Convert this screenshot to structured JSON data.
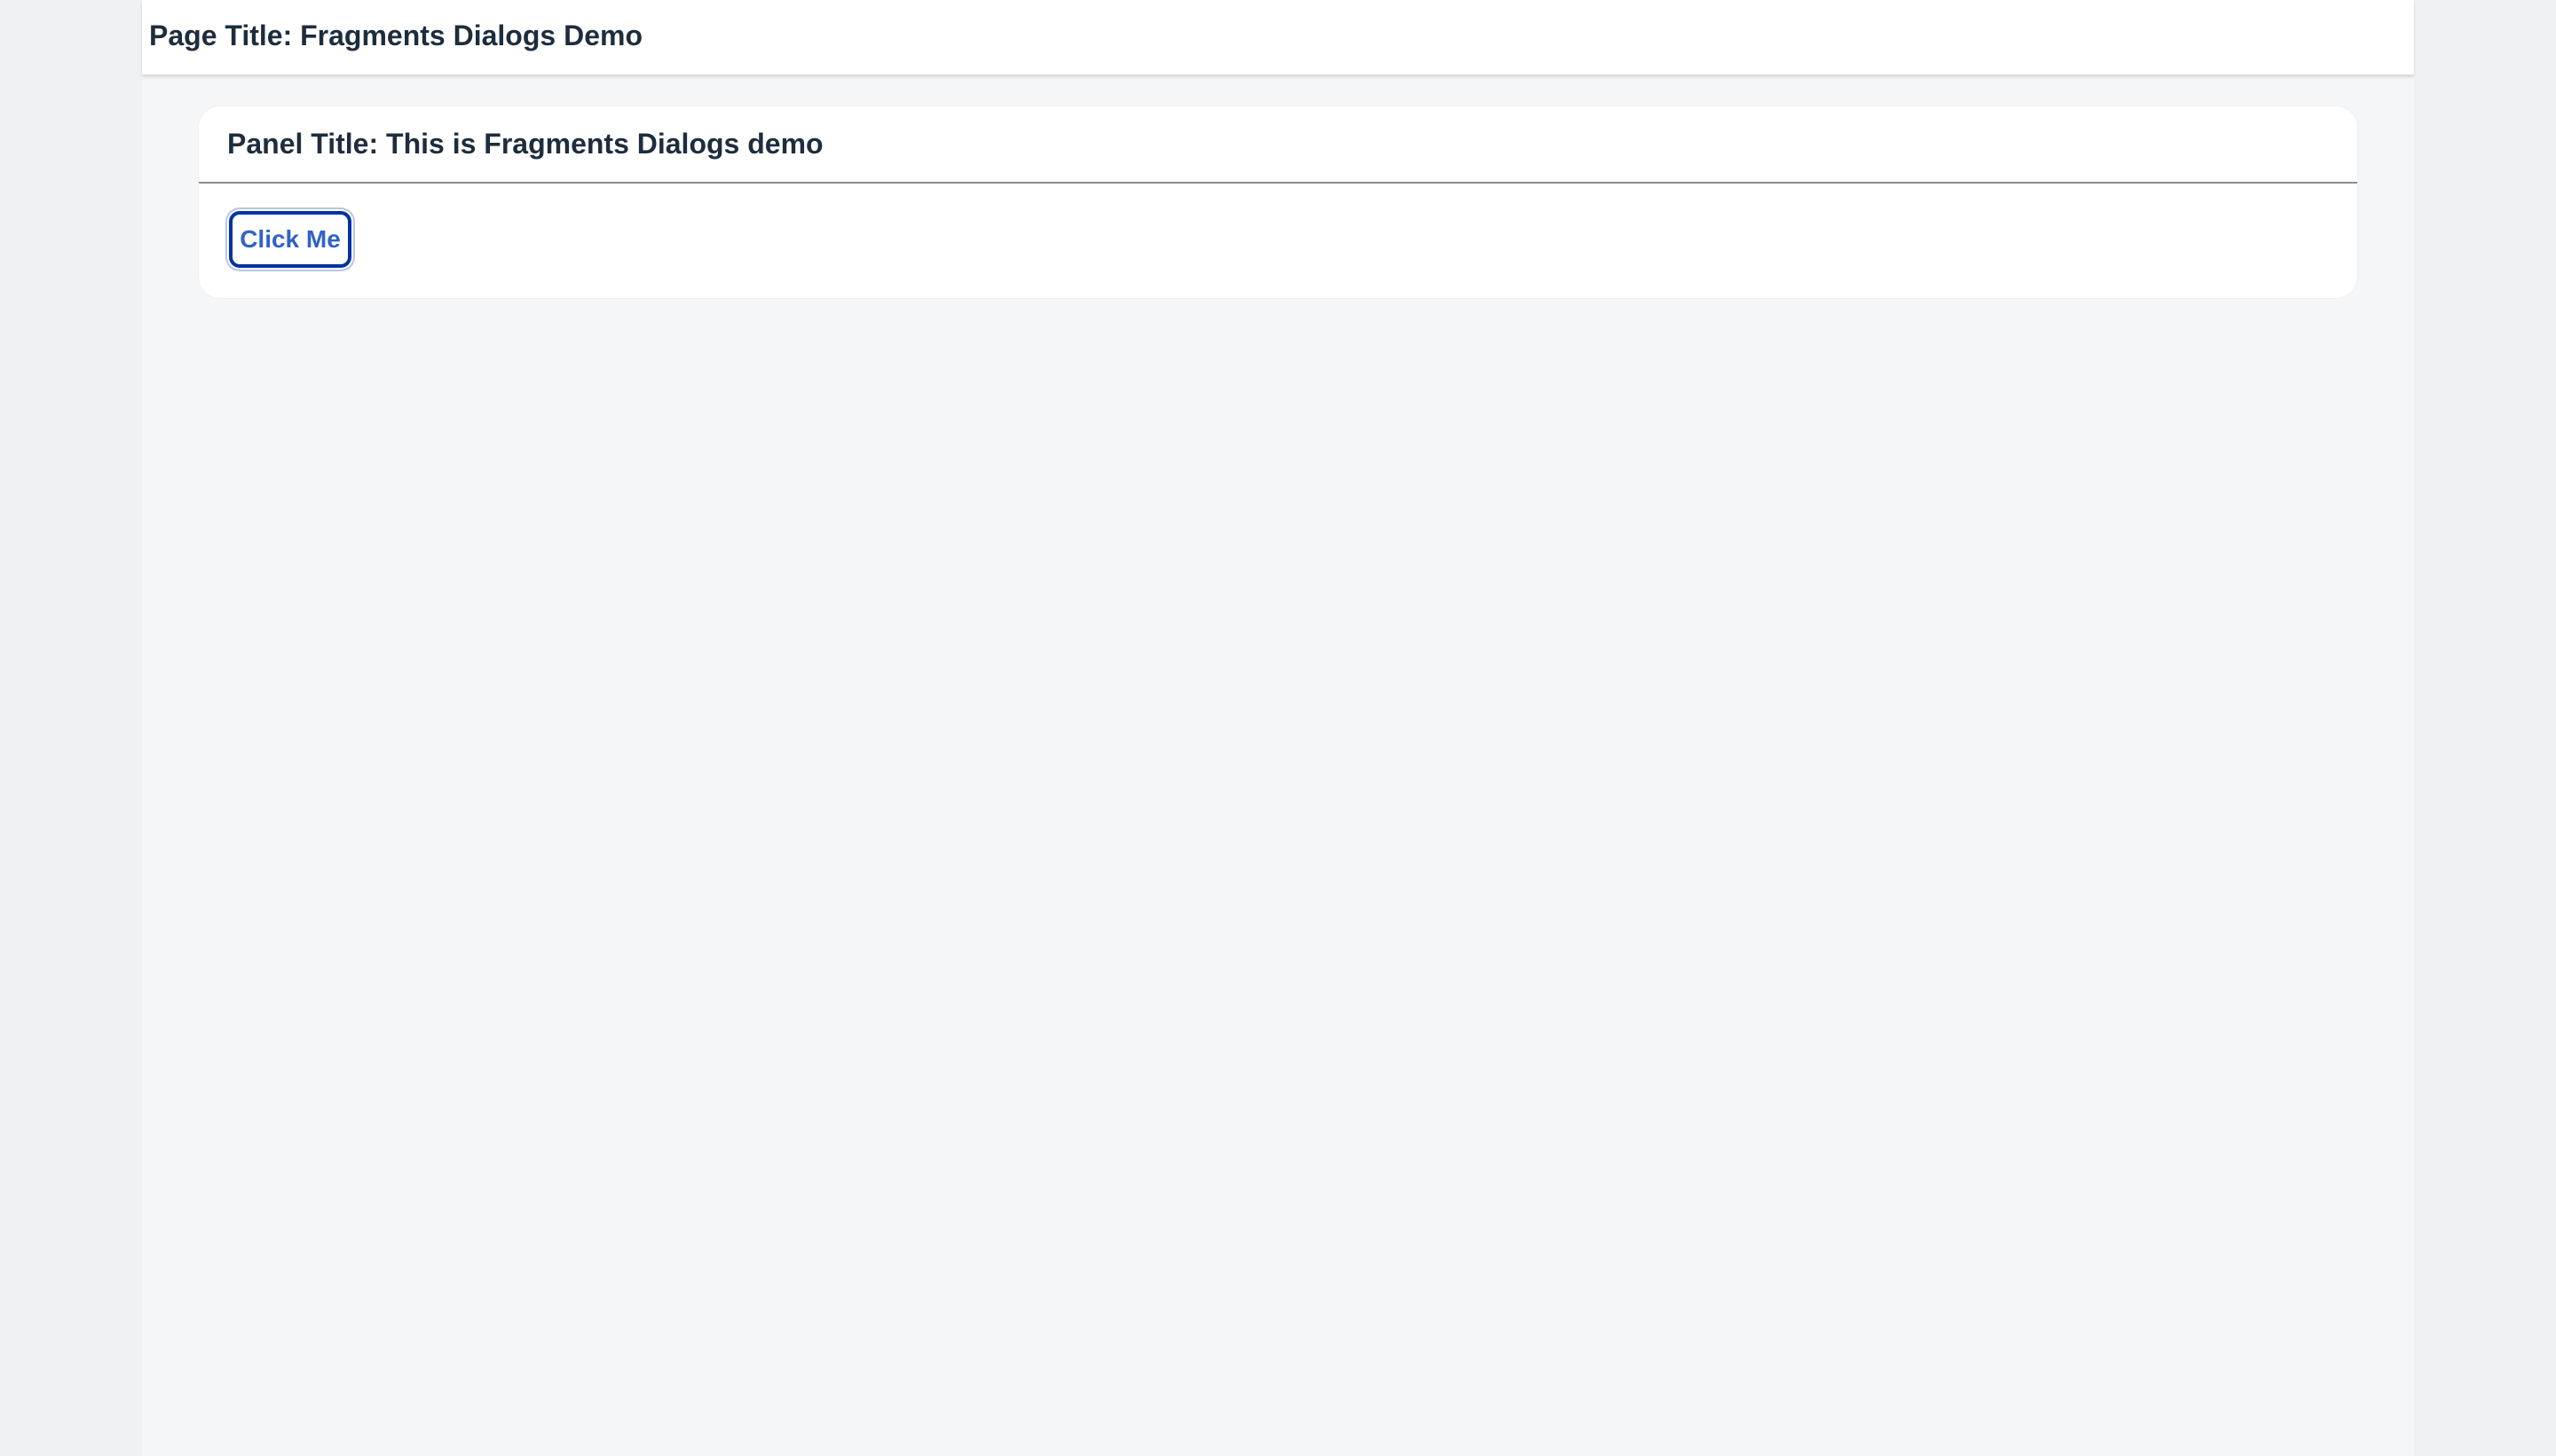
{
  "page": {
    "title": "Page Title: Fragments Dialogs Demo"
  },
  "panel": {
    "title": "Panel Title: This is Fragments Dialogs demo",
    "button_label": "Click Me"
  },
  "colors": {
    "background": "#eff1f2",
    "shell_background": "#f5f6f7",
    "title_text": "#1d2d3e",
    "button_text": "#2f62c9",
    "button_focus_border": "#0032a5"
  }
}
